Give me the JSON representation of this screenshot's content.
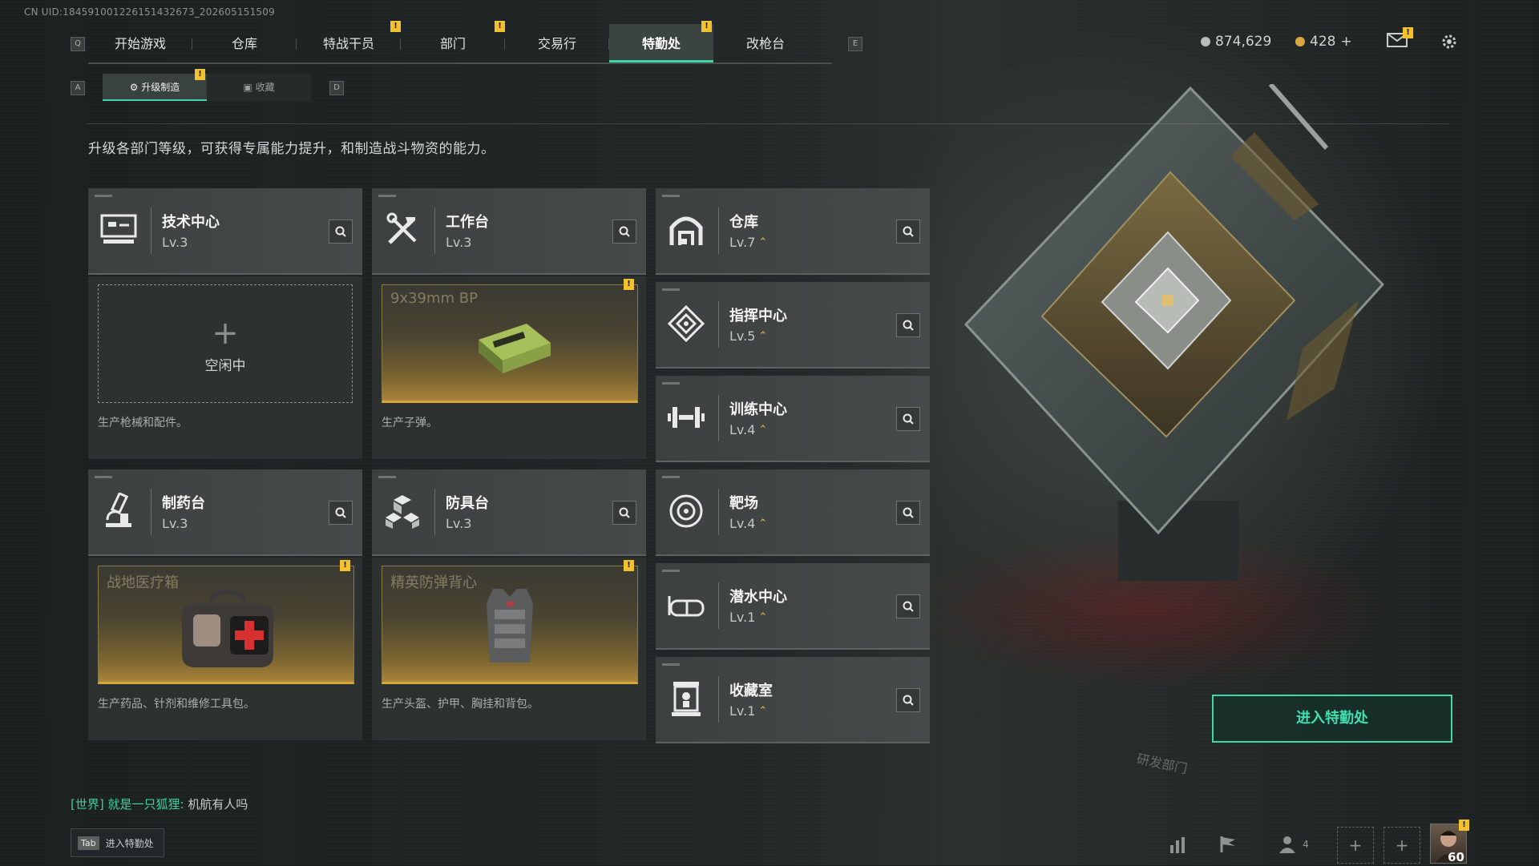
{
  "uid_text": "CN UID:1845910012261514326​73_202605151509",
  "nav": {
    "left_key": "Q",
    "right_key": "E",
    "tabs": [
      {
        "label": "开始游戏",
        "warn": false,
        "active": false
      },
      {
        "label": "仓库",
        "warn": false,
        "active": false
      },
      {
        "label": "特战干员",
        "warn": true,
        "active": false
      },
      {
        "label": "部门",
        "warn": true,
        "active": false
      },
      {
        "label": "交易行",
        "warn": false,
        "active": false
      },
      {
        "label": "特勤处",
        "warn": true,
        "active": true
      },
      {
        "label": "改枪台",
        "warn": false,
        "active": false
      }
    ],
    "warn_glyph": "!"
  },
  "currency": {
    "coins": "874,629",
    "coins_color": "#b8bcba",
    "tokens": "428",
    "tokens_color": "#d8a840",
    "add_symbol": "+"
  },
  "subnav": {
    "left_key": "A",
    "right_key": "D",
    "tabs": [
      {
        "label": "升级制造",
        "icon": "craft-icon",
        "active": true
      },
      {
        "label": "收藏",
        "icon": "collection-icon",
        "active": false
      }
    ]
  },
  "description": "升级各部门等级，可获得专属能力提升，和制造战斗物资的能力。",
  "departments": {
    "tech": {
      "name": "技术中心",
      "level": "Lv.3",
      "icon": "computer-icon"
    },
    "workbench": {
      "name": "工作台",
      "level": "Lv.3",
      "icon": "tools-icon"
    },
    "pharmacy": {
      "name": "制药台",
      "level": "Lv.3",
      "icon": "microscope-icon"
    },
    "armor": {
      "name": "防具台",
      "level": "Lv.3",
      "icon": "blocks-icon"
    },
    "right": [
      {
        "name": "仓库",
        "level": "Lv.7",
        "icon": "warehouse-icon"
      },
      {
        "name": "指挥中心",
        "level": "Lv.5",
        "icon": "command-icon"
      },
      {
        "name": "训练中心",
        "level": "Lv.4",
        "icon": "dumbbell-icon"
      },
      {
        "name": "靶场",
        "level": "Lv.4",
        "icon": "target-icon"
      },
      {
        "name": "潜水中心",
        "level": "Lv.1",
        "icon": "goggles-icon"
      },
      {
        "name": "收藏室",
        "level": "Lv.1",
        "icon": "display-case-icon"
      }
    ],
    "upgrade_glyph": "⌃"
  },
  "production": {
    "tech": {
      "state": "idle",
      "idle_label": "空闲中",
      "plus": "+",
      "desc": "生产枪械和配件。"
    },
    "workbench": {
      "state": "busy",
      "item": "9x39mm BP",
      "desc": "生产子弹。"
    },
    "pharmacy": {
      "state": "busy",
      "item": "战地医疗箱",
      "desc": "生产药品、针剂和维修工具包。"
    },
    "armor": {
      "state": "busy",
      "item": "精英防弹背心",
      "desc": "生产头盔、护甲、胸挂和背包。"
    }
  },
  "enter_button": "进入特勤处",
  "chat": {
    "channel": "[世界]",
    "nick": "就是一只狐狸:",
    "message": "机航有人吗"
  },
  "tab_hint": {
    "key": "Tab",
    "label": "进入特勤处"
  },
  "bottom_bar": {
    "squad_count": "4",
    "player_level": "60"
  },
  "building_sign": "研发部门",
  "accent_color": "#3fd7a6",
  "warn_color": "#f2c12e"
}
